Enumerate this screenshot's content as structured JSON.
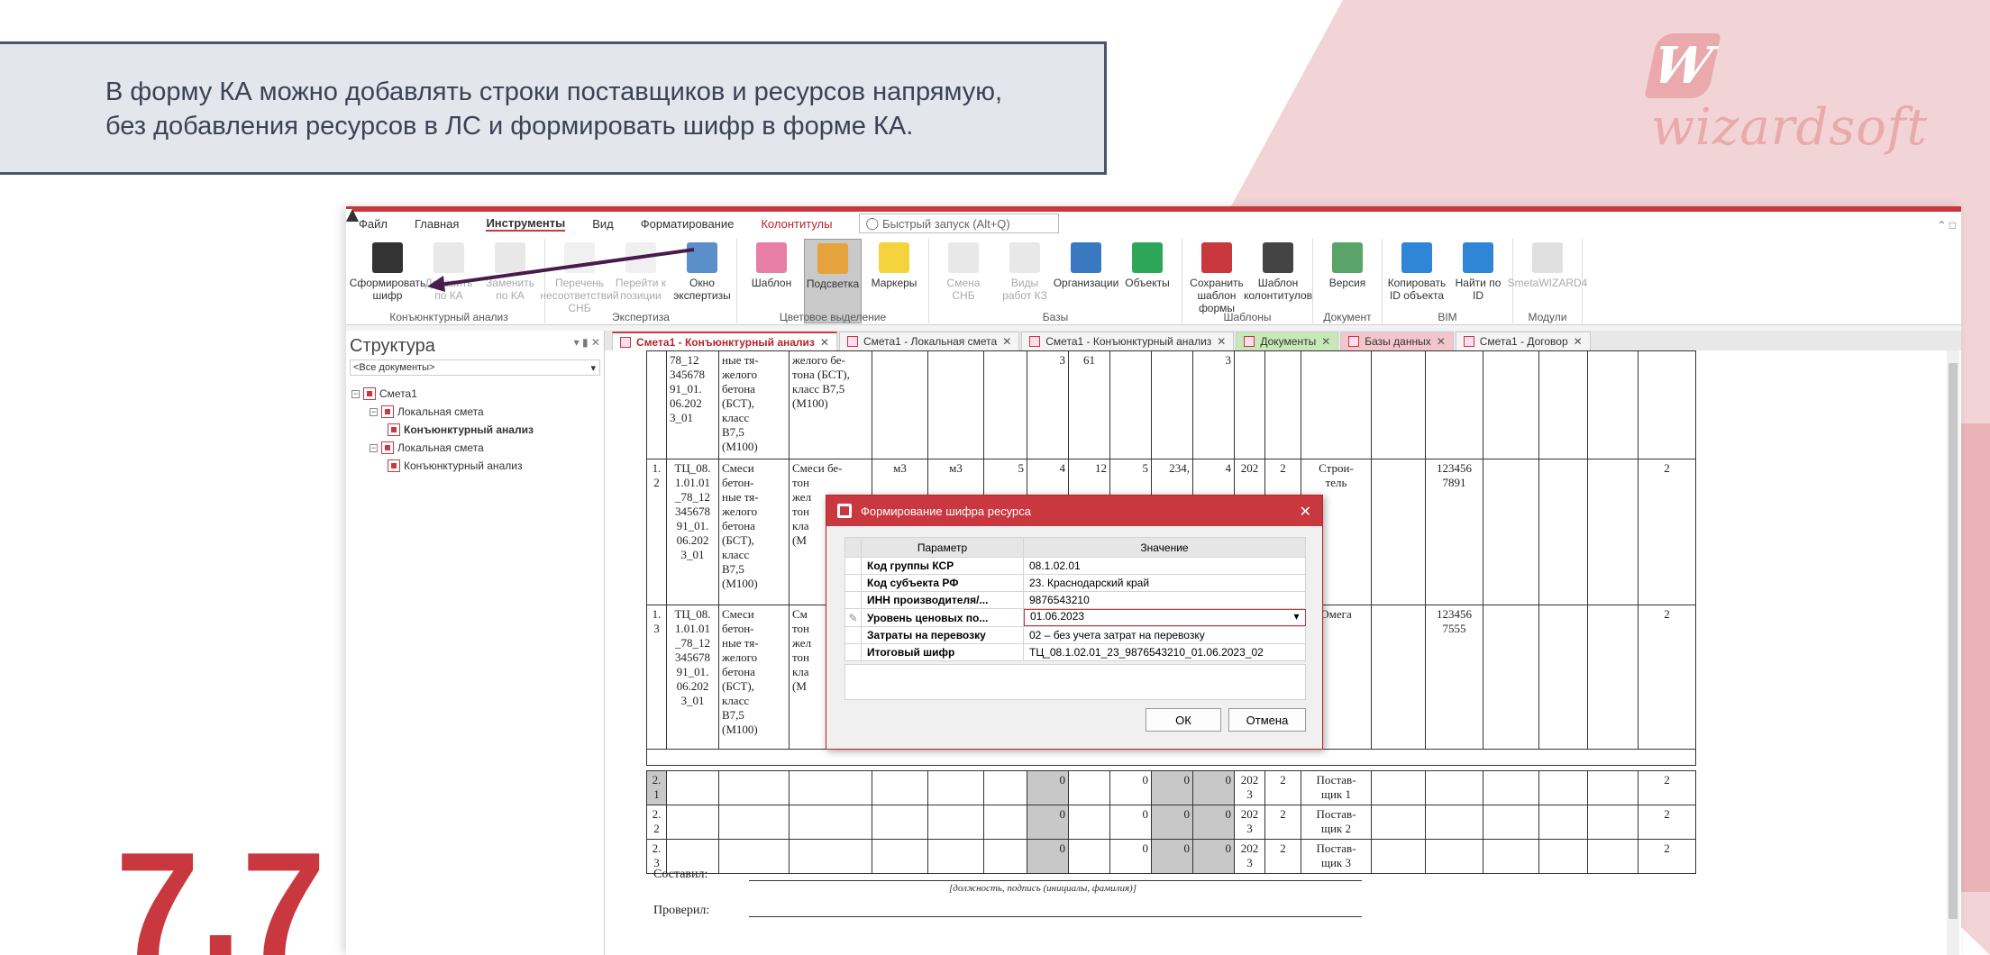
{
  "callout": {
    "line1": "В форму КА можно добавлять строки поставщиков и ресурсов напрямую,",
    "line2": "без добавления ресурсов в ЛС и формировать шифр в форме КА."
  },
  "slide_number": "7.7",
  "logo_text": "wizardsoft",
  "brand_color": "#c9383f",
  "menu": {
    "items": [
      "Файл",
      "Главная",
      "Инструменты",
      "Вид",
      "Форматирование",
      "Колонтитулы"
    ],
    "active": "Инструменты",
    "quick_access_placeholder": "Быстрый запуск (Alt+Q)"
  },
  "ribbon": {
    "groups": [
      {
        "label": "Конъюнктурный анализ",
        "buttons": [
          {
            "text": "Сформировать шифр",
            "icon": "qr-code-icon",
            "disabled": false
          },
          {
            "text": "Добавить по КА",
            "icon": "qr-add-icon",
            "disabled": true
          },
          {
            "text": "Заменить по КА",
            "icon": "qr-replace-icon",
            "disabled": true
          }
        ]
      },
      {
        "label": "Экспертиза",
        "buttons": [
          {
            "text": "Перечень несоответствий СНБ",
            "icon": "list-icon",
            "disabled": true
          },
          {
            "text": "Перейти к позиции",
            "icon": "goto-icon",
            "disabled": true
          },
          {
            "text": "Окно экспертизы",
            "icon": "expertise-icon",
            "disabled": false
          }
        ]
      },
      {
        "label": "Цветовое выделение",
        "buttons": [
          {
            "text": "Шаблон",
            "icon": "template-icon",
            "disabled": false
          },
          {
            "text": "Подсветка",
            "icon": "palette-icon",
            "disabled": false,
            "selected": true
          },
          {
            "text": "Маркеры",
            "icon": "bulb-icon",
            "disabled": false
          }
        ]
      },
      {
        "label": "Базы",
        "buttons": [
          {
            "text": "Смена СНБ",
            "icon": "database-icon",
            "disabled": true
          },
          {
            "text": "Виды работ КЗ",
            "icon": "book-icon",
            "disabled": true
          },
          {
            "text": "Организации",
            "icon": "building-icon",
            "disabled": false
          },
          {
            "text": "Объекты",
            "icon": "flag-icon",
            "disabled": false
          }
        ]
      },
      {
        "label": "Шаблоны",
        "buttons": [
          {
            "text": "Сохранить шаблон формы",
            "icon": "form-template-icon",
            "disabled": false
          },
          {
            "text": "Шаблон колонтитулов",
            "icon": "header-template-icon",
            "disabled": false
          }
        ]
      },
      {
        "label": "Документ",
        "buttons": [
          {
            "text": "Версия",
            "icon": "version-icon",
            "disabled": false
          }
        ]
      },
      {
        "label": "BIM",
        "buttons": [
          {
            "text": "Копировать ID объекта",
            "icon": "copy-id-icon",
            "disabled": false
          },
          {
            "text": "Найти по ID",
            "icon": "find-id-icon",
            "disabled": false
          }
        ]
      },
      {
        "label": "Модули",
        "buttons": [
          {
            "text": "SmetaWIZARD4",
            "icon": "atom-icon",
            "disabled": true
          }
        ]
      }
    ]
  },
  "structure": {
    "title": "Структура",
    "filter": "<Все документы>",
    "tree": [
      {
        "label": "Смета1",
        "level": 0,
        "bold": false
      },
      {
        "label": "Локальная смета",
        "level": 1,
        "bold": false
      },
      {
        "label": "Конъюнктурный анализ",
        "level": 2,
        "bold": true
      },
      {
        "label": "Локальная смета",
        "level": 1,
        "bold": false
      },
      {
        "label": "Конъюнктурный анализ",
        "level": 2,
        "bold": false
      }
    ]
  },
  "tabs": [
    {
      "label": "Смета1 - Конъюнктурный анализ",
      "active": true,
      "style": ""
    },
    {
      "label": "Смета1 - Локальная смета",
      "active": false,
      "style": ""
    },
    {
      "label": "Смета1 - Конъюнктурный анализ",
      "active": false,
      "style": ""
    },
    {
      "label": "Документы",
      "active": false,
      "style": "green"
    },
    {
      "label": "Базы данных",
      "active": false,
      "style": "pink"
    },
    {
      "label": "Смета1 - Договор",
      "active": false,
      "style": ""
    }
  ],
  "grid": {
    "row0": {
      "code": "78_12\n345678\n91_01.\n06.202\n3_01",
      "name1": "ные тя-\nжелого\nбетона\n(БСТ),\nкласс\nВ7,5\n(М100)",
      "name2": "желого бе-\nтона (БСТ),\nкласс В7,5\n(М100)",
      "q1": "3",
      "q2": "61",
      "q3": "3"
    },
    "row12": {
      "num": "1.\n2",
      "code": "ТЦ_08.\n1.01.01\n_78_12\n345678\n91_01.\n06.202\n3_01",
      "name1": "Смеси\nбетон-\nные тя-\nжелого\nбетона\n(БСТ),\nкласс\nВ7,5\n(М100)",
      "name2": "Смеси бе-\nтон\nжел\nтон\nкла\n(М",
      "u1": "м3",
      "u2": "м3",
      "a": "5",
      "b": "4",
      "c": "12",
      "d": "5",
      "e": "234,",
      "f": "4",
      "g": "202",
      "h": "2",
      "supplier": "Строи-\nтель",
      "inn": "123456\n7891",
      "last": "2"
    },
    "row13": {
      "num": "1.\n3",
      "code": "ТЦ_08.\n1.01.01\n_78_12\n345678\n91_01.\n06.202\n3_01",
      "name1": "Смеси\nбетон-\nные тя-\nжелого\nбетона\n(БСТ),\nкласс\nВ7,5\n(М100)",
      "name2": "См\nтон\nжел\nтон\nкла\n(М",
      "supplier": "Омега",
      "inn": "123456\n7555",
      "last": "2"
    },
    "suppliers": [
      {
        "num": "2.\n1",
        "v1": "0",
        "v2": "0",
        "v3": "0",
        "v4": "0",
        "year": "202\n3",
        "n": "2",
        "name": "Постав-\nщик 1",
        "last": "2"
      },
      {
        "num": "2.\n2",
        "v1": "0",
        "v2": "0",
        "v3": "0",
        "v4": "0",
        "year": "202\n3",
        "n": "2",
        "name": "Постав-\nщик 2",
        "last": "2"
      },
      {
        "num": "2.\n3",
        "v1": "0",
        "v2": "0",
        "v3": "0",
        "v4": "0",
        "year": "202\n3",
        "n": "2",
        "name": "Постав-\nщик 3",
        "last": "2"
      }
    ]
  },
  "signatures": {
    "composed": "Составил:",
    "checked": "Проверил:",
    "caption": "[должность, подпись (инициалы, фамилия)]"
  },
  "dialog": {
    "title": "Формирование шифра ресурса",
    "col_param": "Параметр",
    "col_value": "Значение",
    "rows": [
      {
        "param": "Код группы КСР",
        "value": "08.1.02.01"
      },
      {
        "param": "Код субъекта РФ",
        "value": "23. Краснодарский край"
      },
      {
        "param": "ИНН производителя/...",
        "value": "9876543210"
      },
      {
        "param": "Уровень ценовых по...",
        "value": "01.06.2023",
        "editing": true
      },
      {
        "param": "Затраты на перевозку",
        "value": "02 – без учета затрат на перевозку"
      },
      {
        "param": "Итоговый шифр",
        "value": "ТЦ_08.1.02.01_23_9876543210_01.06.2023_02"
      }
    ],
    "ok": "ОК",
    "cancel": "Отмена"
  }
}
